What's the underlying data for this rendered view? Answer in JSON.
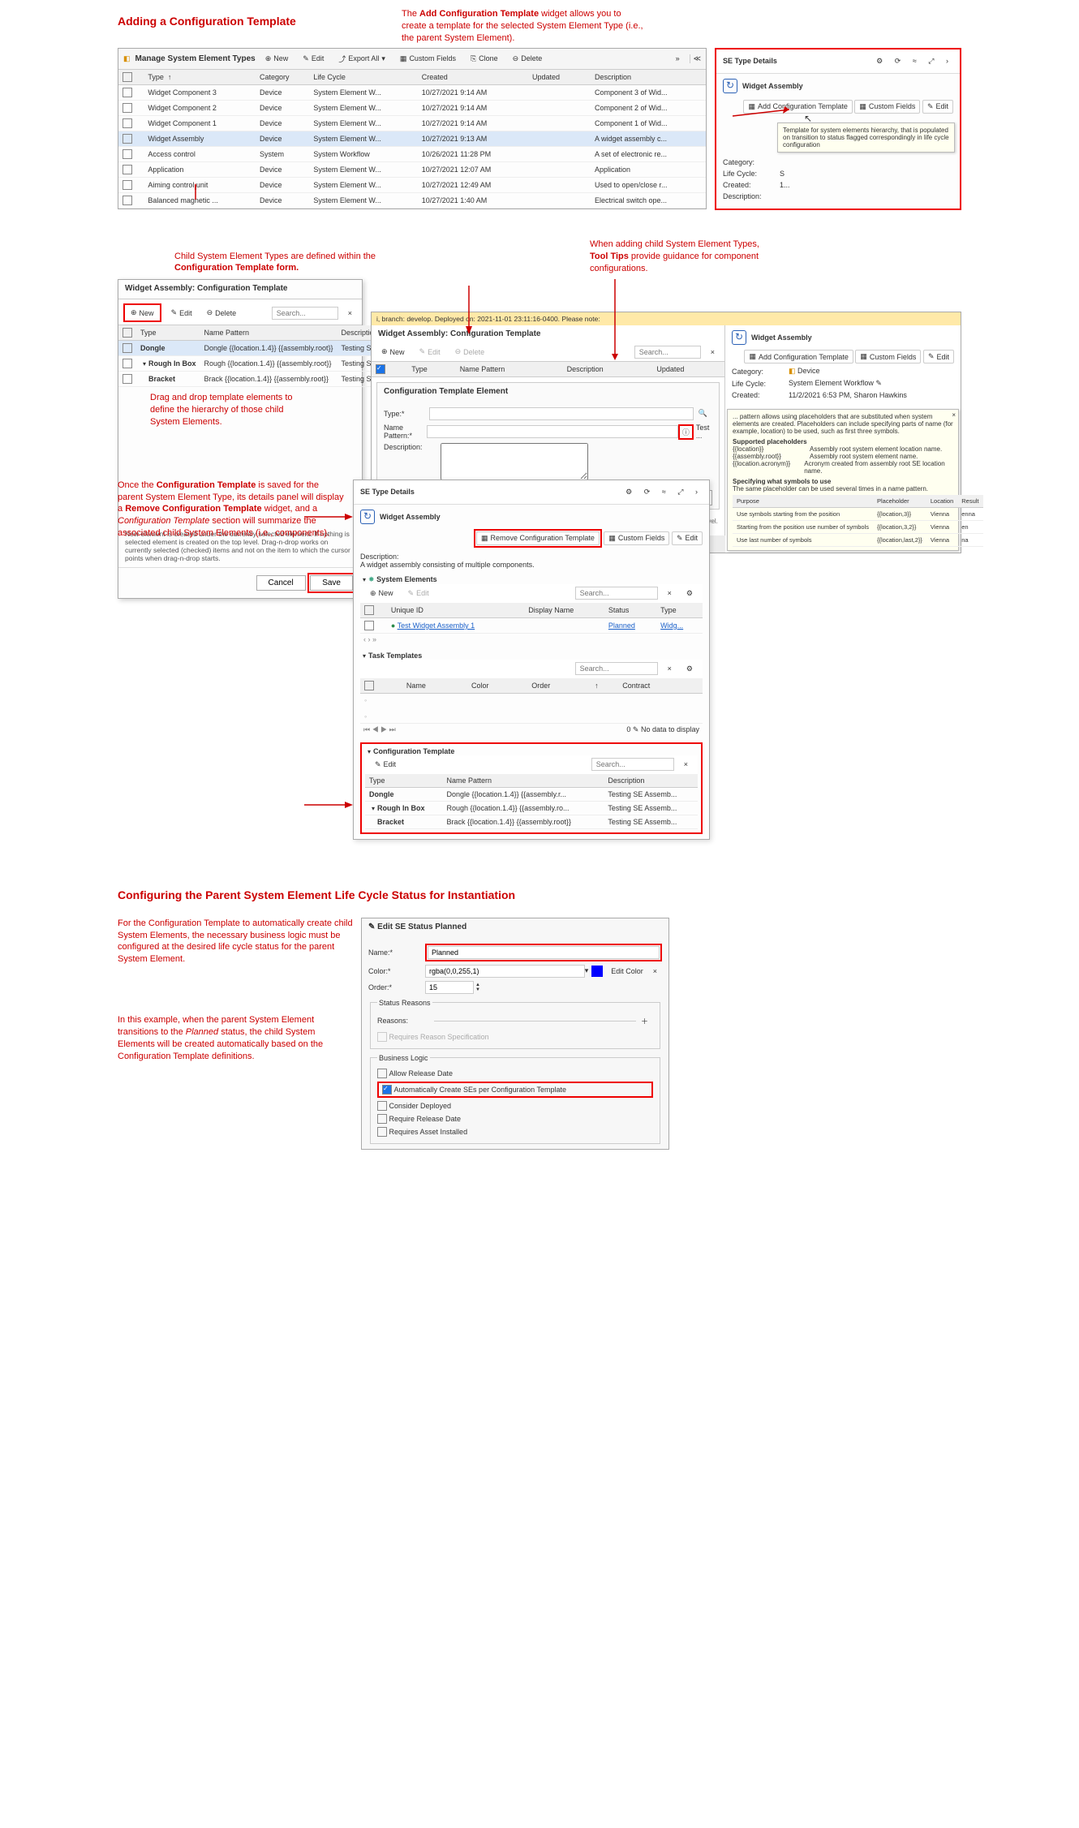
{
  "headings": {
    "h1": "Adding a Configuration Template",
    "h2": "Configuring the Parent System Element Life Cycle Status for Instantiation"
  },
  "captions": {
    "top_right": "The <b>Add Configuration Template</b> widget allows you to create a template for the selected System Element Type (i.e., the parent System Element).",
    "mid_left": "Child System Element Types are defined within the <b>Configuration Template form.</b>",
    "tooltip_caption": "When adding child System Element Types, <b>Tool Tips</b> provide guidance for component configurations.",
    "drag_caption": "Drag and drop template elements to define the hierarchy of those child System Elements.",
    "saved_caption": "Once the <b>Configuration Template</b> is saved for the parent System Element Type, its details panel will display a <b>Remove Configuration Template</b> widget, and a <i>Configuration Template</i> section will summarize the associated child System Elements (i.e., components).",
    "lc_caption1": "For the Configuration Template to automatically create child System Elements, the necessary business logic must be configured at the desired life cycle status for the parent System Element.",
    "lc_caption2": "In this example, when the parent System Element transitions to the <i>Planned</i> status, the child System Elements will be created automatically based on the Configuration Template definitions."
  },
  "manage_panel": {
    "title": "Manage System Element Types",
    "buttons": {
      "new": "New",
      "edit": "Edit",
      "export": "Export All",
      "custom": "Custom Fields",
      "clone": "Clone",
      "delete": "Delete"
    },
    "cols": [
      "Type",
      "Category",
      "Life Cycle",
      "Created",
      "Updated",
      "",
      "Description"
    ],
    "rows": [
      {
        "t": "Widget Component 3",
        "c": "Device",
        "lc": "System Element W...",
        "cr": "10/27/2021 9:14 AM",
        "u": "",
        "d": "Component 3 of Wid..."
      },
      {
        "t": "Widget Component 2",
        "c": "Device",
        "lc": "System Element W...",
        "cr": "10/27/2021 9:14 AM",
        "u": "",
        "d": "Component 2 of Wid..."
      },
      {
        "t": "Widget Component 1",
        "c": "Device",
        "lc": "System Element W...",
        "cr": "10/27/2021 9:14 AM",
        "u": "",
        "d": "Component 1 of Wid..."
      },
      {
        "t": "Widget Assembly",
        "c": "Device",
        "lc": "System Element W...",
        "cr": "10/27/2021 9:13 AM",
        "u": "",
        "d": "A widget assembly c...",
        "sel": true
      },
      {
        "t": "Access control",
        "c": "System",
        "lc": "System Workflow",
        "cr": "10/26/2021 11:28 PM",
        "u": "",
        "d": "A set of electronic re..."
      },
      {
        "t": "Application",
        "c": "Device",
        "lc": "System Element W...",
        "cr": "10/27/2021 12:07 AM",
        "u": "",
        "d": "Application"
      },
      {
        "t": "Aiming control unit",
        "c": "Device",
        "lc": "System Element W...",
        "cr": "10/27/2021 12:49 AM",
        "u": "",
        "d": "Used to open/close r..."
      },
      {
        "t": "Balanced magnetic ...",
        "c": "Device",
        "lc": "System Element W...",
        "cr": "10/27/2021 1:40 AM",
        "u": "",
        "d": "Electrical switch ope..."
      }
    ]
  },
  "se_type_details": {
    "title": "SE Type Details",
    "name": "Widget Assembly",
    "buttons": {
      "add_cfg": "Add Configuration Template",
      "custom": "Custom Fields",
      "edit": "Edit"
    },
    "labels": {
      "category": "Category:",
      "lifecycle": "Life Cycle:",
      "created": "Created:",
      "description": "Description:"
    },
    "tooltip": "Template for system elements hierarchy, that is populated on transition to status flagged correspondingly in life cycle configuration",
    "lc_prefix": "S",
    "cr_prefix": "1..."
  },
  "config_form": {
    "title": "Widget Assembly: Configuration Template",
    "buttons": {
      "new": "New",
      "edit": "Edit",
      "delete": "Delete",
      "cancel": "Cancel",
      "save": "Save"
    },
    "search_ph": "Search...",
    "cols": [
      "Type",
      "Name Pattern",
      "Description"
    ],
    "rows": [
      {
        "t": "Dongle",
        "np": "Dongle {{location.1.4}} {{assembly.root}}",
        "d": "Testing SE Assembly...",
        "sel": true
      },
      {
        "t": "Rough In Box",
        "np": "Rough {{location.1.4}} {{assembly.root}}",
        "d": "Testing SE Assembly..."
      },
      {
        "t": "Bracket",
        "np": "Brack {{location.1.4}} {{assembly.root}}",
        "d": "Testing SE Assembly...",
        "indent": true
      }
    ],
    "footer": "New element is created under the currently selected element. If nothing is selected element is created on the top level. Drag-n-drop works on currently selected (checked) items and not on the item to which the cursor points when drag-n-drop starts."
  },
  "inline_editor": {
    "banner": "i, branch: develop. Deployed on: 2021-11-01 23:11:16-0400. Please note:",
    "title": "Widget Assembly: Configuration Template",
    "buttons": {
      "new": "New",
      "edit": "Edit",
      "delete": "Delete",
      "save": "Save",
      "cancel": "Cancel",
      "add_cfg": "Add Configuration Template",
      "custom": "Custom Fields",
      "editbtn": "Edit"
    },
    "cols": [
      "Type",
      "Name Pattern",
      "Description",
      "Updated"
    ],
    "element_panel": {
      "title": "Configuration Template Element",
      "labels": {
        "type": "Type:*",
        "name_pattern": "Name Pattern:*",
        "description": "Description:"
      },
      "info_tip": "Test ...",
      "footer": "New element is created under the currently selected element. If nothing is selected element is created on the top level. Drag-n-drop works on currently selected (checked)"
    },
    "right_details": {
      "name": "Widget Assembly",
      "category": "Device",
      "lifecycle": "System Element Workflow",
      "created": "11/2/2021 6:53 PM, Sharon Hawkins",
      "labels": {
        "category": "Category:",
        "lifecycle": "Life Cycle:",
        "created": "Created:"
      }
    },
    "tooltip_big": {
      "lead": "... pattern allows using placeholders that are substituted when system elements are created. Placeholders can include specifying parts of name (for example, location) to be used, such as first three symbols.",
      "h1": "Supported placeholders",
      "ph": [
        {
          "k": "{{location}}",
          "v": "Assembly root system element location name."
        },
        {
          "k": "{{assembly.root}}",
          "v": "Assembly root system element name."
        },
        {
          "k": "{{location.acronym}}",
          "v": "Acronym created from assembly root SE location name."
        }
      ],
      "h2": "Specifying what symbols to use",
      "sub": "The same placeholder can be used several times in a name pattern.",
      "table_head": [
        "Purpose",
        "Placeholder",
        "Location",
        "Result"
      ],
      "table": [
        [
          "Use symbols starting from the position",
          "{{location,3}}",
          "Vienna",
          "enna"
        ],
        [
          "Starting from the position use number of symbols",
          "{{location,3,2}}",
          "Vienna",
          "en"
        ],
        [
          "Use last number of symbols",
          "{{location,last,2}}",
          "Vienna",
          "na"
        ]
      ]
    }
  },
  "details_after_save": {
    "title": "SE Type Details",
    "name": "Widget Assembly",
    "buttons": {
      "remove_cfg": "Remove Configuration Template",
      "custom": "Custom Fields",
      "edit": "Edit",
      "new": "New",
      "editbtn": "Edit",
      "ct_edit": "Edit"
    },
    "description_label": "Description:",
    "description": "A widget assembly consisting of multiple components.",
    "sections": {
      "se": "System Elements",
      "tt": "Task Templates",
      "ct": "Configuration Template"
    },
    "se_cols": [
      "Unique ID",
      "Display Name",
      "Status",
      "Type"
    ],
    "se_row": {
      "id": "Test Widget Assembly 1",
      "dn": "",
      "status": "Planned",
      "type": "Widg..."
    },
    "tt_cols": [
      "Name",
      "Color",
      "Order",
      "",
      "Contract"
    ],
    "tt_footer": "No data to display",
    "tt_count": "0",
    "search_ph": "Search...",
    "ct_cols": [
      "Type",
      "Name Pattern",
      "Description"
    ],
    "ct_rows": [
      {
        "t": "Dongle",
        "np": "Dongle {{location.1.4}} {{assembly.r...",
        "d": "Testing SE Assemb..."
      },
      {
        "t": "Rough In Box",
        "np": "Rough {{location.1.4}} {{assembly.ro...",
        "d": "Testing SE Assemb..."
      },
      {
        "t": "Bracket",
        "np": "Brack {{location.1.4}} {{assembly.root}}",
        "d": "Testing SE Assemb...",
        "indent": true
      }
    ]
  },
  "edit_status": {
    "title": "Edit SE Status Planned",
    "labels": {
      "name": "Name:*",
      "color": "Color:*",
      "order": "Order:*",
      "reasons": "Reasons:",
      "sr_legend": "Status Reasons",
      "bl_legend": "Business Logic",
      "edit_color": "Edit Color"
    },
    "values": {
      "name": "Planned",
      "color": "rgba(0,0,255,1)",
      "order": "15"
    },
    "opts": {
      "req_reason": "Requires Reason Specification",
      "allow_release": "Allow Release Date",
      "auto_create": "Automatically Create SEs per Configuration Template",
      "consider_deployed": "Consider Deployed",
      "req_release": "Require Release Date",
      "req_asset": "Requires Asset Installed"
    }
  }
}
